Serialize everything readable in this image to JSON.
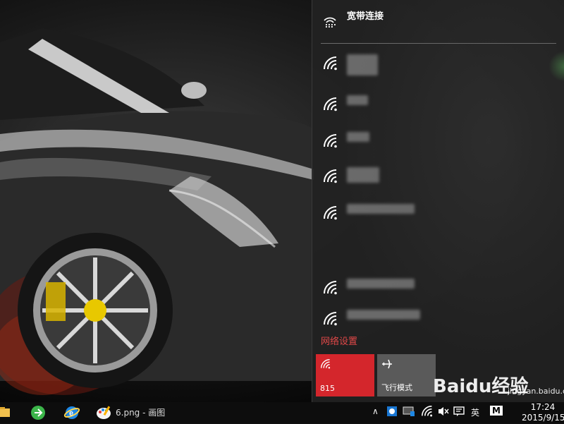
{
  "flyout": {
    "connection_label": "宽带连接",
    "networks": [
      {
        "name": "",
        "icon": "wifi-icon"
      },
      {
        "name": "",
        "icon": "wifi-icon"
      },
      {
        "name": "",
        "icon": "wifi-icon"
      },
      {
        "name": "",
        "icon": "wifi-icon"
      },
      {
        "name": "",
        "icon": "wifi-icon"
      },
      {
        "name": "",
        "icon": "wifi-icon"
      },
      {
        "name": "",
        "icon": "wifi-icon"
      }
    ],
    "network_settings_label": "网络设置",
    "tiles": {
      "wifi_label": "815",
      "airplane_label": "飞行模式"
    },
    "accent_color": "#d4262c"
  },
  "watermark": {
    "text": "Baidu经验",
    "sub": "jingyan.baidu.com"
  },
  "taskbar": {
    "open_app_label": "6.png - 画图",
    "ime_label": "英",
    "ime_mode": "M",
    "time": "17:24",
    "date": "2015/9/15"
  }
}
